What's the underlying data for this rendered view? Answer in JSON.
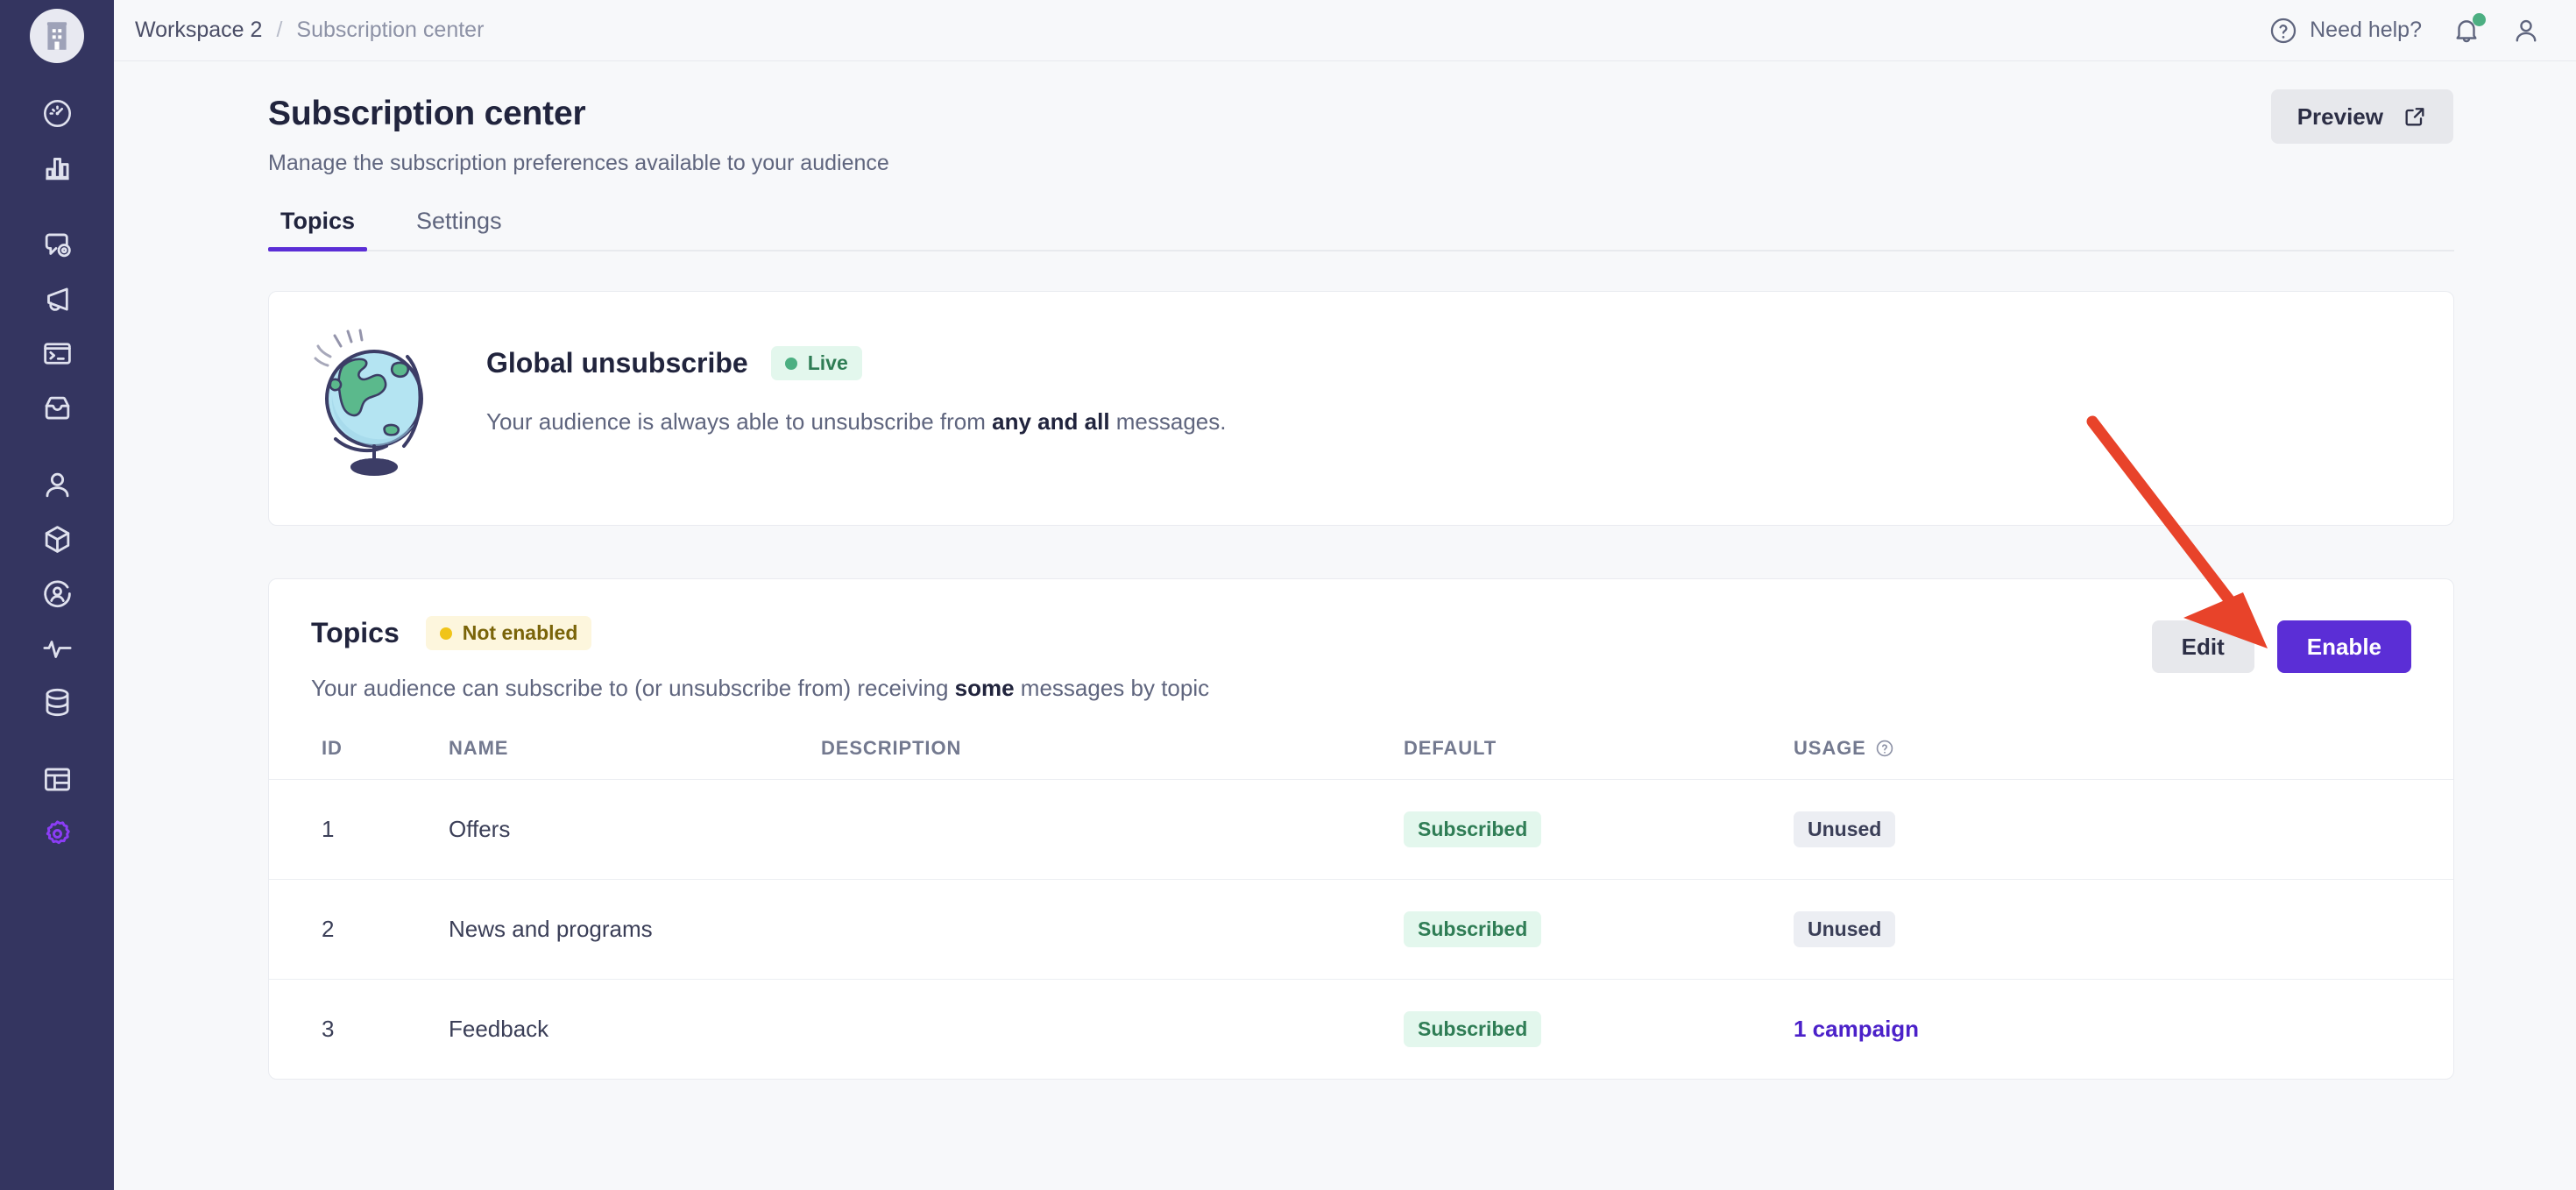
{
  "sidebar": {
    "logo": {
      "name": "company-building-logo"
    },
    "items": [
      {
        "name": "dashboard",
        "icon": "speedometer-icon"
      },
      {
        "name": "analytics",
        "icon": "bar-chart-icon"
      },
      {
        "name": "messaging",
        "icon": "chat-target-icon"
      },
      {
        "name": "campaigns",
        "icon": "megaphone-icon"
      },
      {
        "name": "developer-console",
        "icon": "terminal-icon"
      },
      {
        "name": "inbox",
        "icon": "inbox-icon"
      },
      {
        "name": "people",
        "icon": "person-icon"
      },
      {
        "name": "objects",
        "icon": "cube-icon"
      },
      {
        "name": "audience",
        "icon": "user-circle-icon"
      },
      {
        "name": "activity",
        "icon": "pulse-icon"
      },
      {
        "name": "data",
        "icon": "database-icon"
      },
      {
        "name": "layouts",
        "icon": "table-layout-icon"
      },
      {
        "name": "settings",
        "icon": "gear-icon",
        "active": true
      }
    ]
  },
  "topbar": {
    "breadcrumb": {
      "workspace": "Workspace 2",
      "separator": "/",
      "current": "Subscription center"
    },
    "need_help_label": "Need help?",
    "help_icon": "question-circle-icon",
    "bell_icon": "bell-icon",
    "bell_has_notification": true,
    "avatar_icon": "user-avatar-icon"
  },
  "page": {
    "title": "Subscription center",
    "subtitle": "Manage the subscription preferences available to your audience",
    "preview_button": {
      "label": "Preview",
      "icon": "external-link-icon"
    }
  },
  "tabs": [
    {
      "label": "Topics",
      "active": true
    },
    {
      "label": "Settings",
      "active": false
    }
  ],
  "global_unsubscribe": {
    "illustration": "globe-illustration",
    "title": "Global unsubscribe",
    "status_badge": "Live",
    "description_prefix": "Your audience is always able to unsubscribe from ",
    "description_bold": "any and all",
    "description_suffix": " messages."
  },
  "topics_section": {
    "title": "Topics",
    "status_badge": "Not enabled",
    "description_prefix": "Your audience can subscribe to (or unsubscribe from) receiving ",
    "description_bold": "some",
    "description_suffix": " messages by topic",
    "edit_button": "Edit",
    "enable_button": "Enable"
  },
  "table": {
    "columns": [
      "ID",
      "NAME",
      "DESCRIPTION",
      "DEFAULT",
      "USAGE"
    ],
    "usage_help_icon": "question-circle-icon",
    "rows": [
      {
        "id": "1",
        "name": "Offers",
        "description": "",
        "default": "Subscribed",
        "usage": "Unused",
        "usage_is_link": false
      },
      {
        "id": "2",
        "name": "News and programs",
        "description": "",
        "default": "Subscribed",
        "usage": "Unused",
        "usage_is_link": false
      },
      {
        "id": "3",
        "name": "Feedback",
        "description": "",
        "default": "Subscribed",
        "usage": "1 campaign",
        "usage_is_link": true
      }
    ]
  },
  "annotation": {
    "arrow_color": "#e8432a",
    "points_to": "enable-button"
  },
  "colors": {
    "sidebar_bg": "#343560",
    "accent_purple": "#5b2ed6",
    "page_bg": "#f7f8fa",
    "live_green": "#4caf82",
    "warn_yellow": "#f0c419",
    "link_purple": "#4b21c9"
  }
}
